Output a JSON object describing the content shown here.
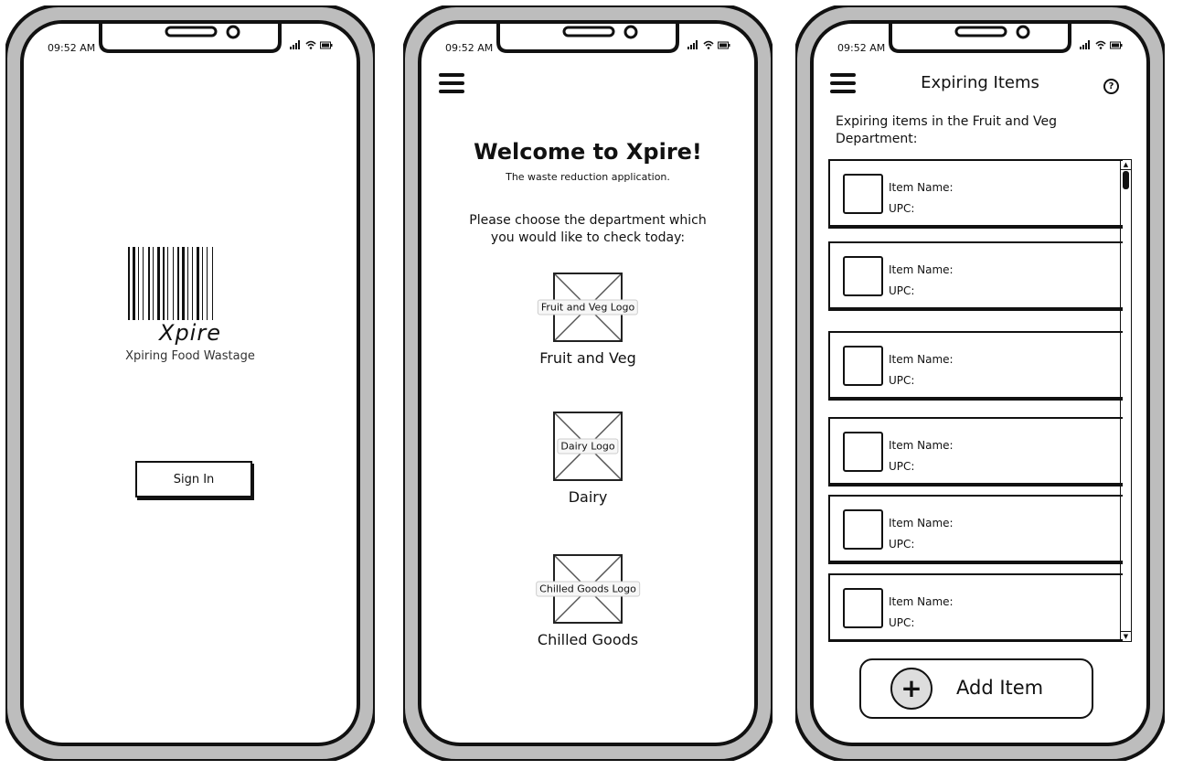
{
  "colors": {
    "frame": "#bdbdbd",
    "ink": "#111111",
    "screen": "#ffffff"
  },
  "status": {
    "time": "09:52 AM"
  },
  "screen1": {
    "brand": "Xpire",
    "tagline": "Xpiring Food Wastage",
    "sign_in_label": "Sign In"
  },
  "screen2": {
    "welcome": "Welcome to Xpire!",
    "subtitle": "The waste reduction application.",
    "prompt": "Please choose the department which you would like to check today:",
    "departments": [
      {
        "logo": "Fruit and Veg Logo",
        "name": "Fruit and Veg"
      },
      {
        "logo": "Dairy Logo",
        "name": "Dairy"
      },
      {
        "logo": "Chilled Goods Logo",
        "name": "Chilled Goods"
      }
    ]
  },
  "screen3": {
    "title": "Expiring Items",
    "help_icon": "?",
    "heading": "Expiring items in the Fruit and Veg Department:",
    "items": [
      {
        "name_label": "Item Name:",
        "upc_label": "UPC:"
      },
      {
        "name_label": "Item Name:",
        "upc_label": "UPC:"
      },
      {
        "name_label": "Item Name:",
        "upc_label": "UPC:"
      },
      {
        "name_label": "Item Name:",
        "upc_label": "UPC:"
      },
      {
        "name_label": "Item Name:",
        "upc_label": "UPC:"
      },
      {
        "name_label": "Item Name:",
        "upc_label": "UPC:"
      }
    ],
    "add_label": "Add Item",
    "add_icon": "+"
  }
}
